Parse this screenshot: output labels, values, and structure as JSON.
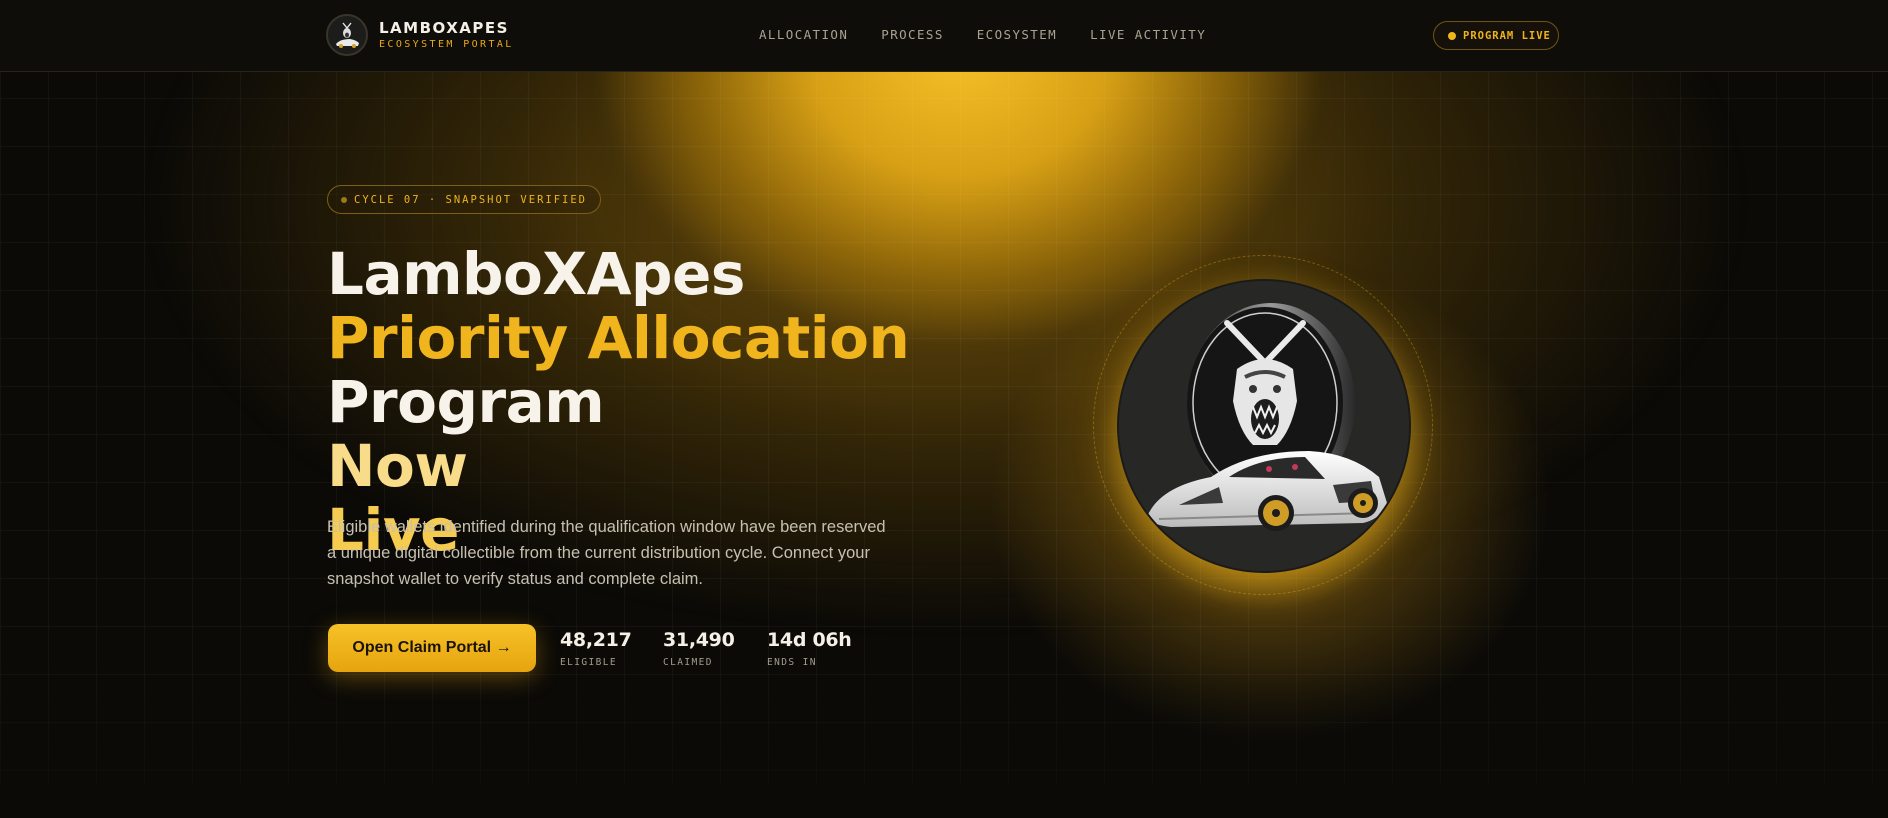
{
  "nav": {
    "brand_name": "LAMBOXAPES",
    "brand_sub": "ECOSYSTEM PORTAL",
    "links": [
      "ALLOCATION",
      "PROCESS",
      "ECOSYSTEM",
      "LIVE ACTIVITY"
    ],
    "status_label": "PROGRAM LIVE"
  },
  "hero": {
    "badge": "CYCLE 07 · SNAPSHOT VERIFIED",
    "headline": {
      "line1": "LamboXApes",
      "line2": "Priority Allocation",
      "line3a": "Program",
      "line3b": "Now",
      "line4": "Live"
    },
    "description": "Eligible wallets identified during the qualification window have been reserved a unique digital collectible from the current distribution cycle. Connect your snapshot wallet to verify status and complete claim.",
    "cta_label": "Open Claim Portal →",
    "stats": [
      {
        "value": "48,217",
        "label": "ELIGIBLE"
      },
      {
        "value": "31,490",
        "label": "CLAIMED"
      },
      {
        "value": "14d 06h",
        "label": "ENDS IN"
      }
    ]
  },
  "colors": {
    "accent": "#f0b41c",
    "background": "#0b0a07",
    "text": "#f7f3ea"
  },
  "icons": {
    "brand_logo": "ape-lambo-logo-icon",
    "hero_image": "ape-coin-lambo-icon"
  }
}
